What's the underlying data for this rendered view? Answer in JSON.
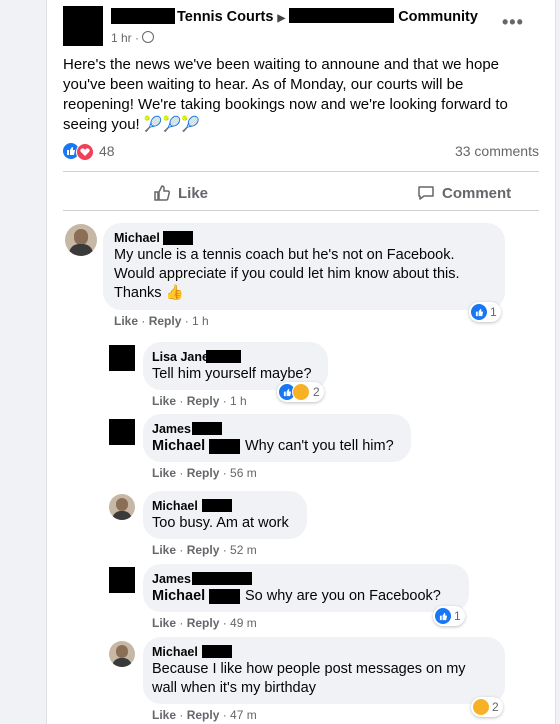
{
  "post": {
    "group_name": "Tennis Courts",
    "community_name": "Community",
    "time": "1 hr",
    "dot": "·",
    "body": "Here's the news we've been waiting to announe and that we hope you've been waiting to hear. As of Monday, our courts will be reopening! We're taking bookings now and we're looking forward to seeing you! 🎾🎾🎾",
    "reaction_count": "48",
    "comments_count": "33 comments",
    "like_label": "Like",
    "comment_label": "Comment"
  },
  "comments": [
    {
      "author": "Michael",
      "lines": [
        "My uncle is a tennis coach but he's not on Facebook.",
        "Would appreciate if you could let him know about this.",
        "Thanks 👍"
      ],
      "like": "Like",
      "reply": "Reply",
      "time": "1 h",
      "reactions": "1"
    },
    {
      "author": "Lisa Jane",
      "lines": [
        "Tell him yourself maybe?"
      ],
      "like": "Like",
      "reply": "Reply",
      "time": "1 h",
      "reactions": "2"
    },
    {
      "author": "James",
      "mention": "Michael",
      "lines": [
        "Why can't you tell him?"
      ],
      "like": "Like",
      "reply": "Reply",
      "time": "56 m"
    },
    {
      "author": "Michael",
      "lines": [
        "Too busy. Am at work"
      ],
      "like": "Like",
      "reply": "Reply",
      "time": "52 m"
    },
    {
      "author": "James",
      "mention": "Michael",
      "lines": [
        "So why are you on Facebook?"
      ],
      "like": "Like",
      "reply": "Reply",
      "time": "49 m",
      "reactions": "1"
    },
    {
      "author": "Michael",
      "lines": [
        "Because I like how people post messages on my",
        "wall when it's my birthday"
      ],
      "like": "Like",
      "reply": "Reply",
      "time": "47 m",
      "reactions": "2"
    }
  ],
  "icons": [
    "globe-icon",
    "more-options-icon",
    "like-reaction-icon",
    "love-reaction-icon",
    "like-outline-icon",
    "comment-icon",
    "haha-reaction-icon",
    "thumbs-up-emoji-icon"
  ],
  "colors": {
    "blue": "#1877f2",
    "text_secondary": "#65676b",
    "bubble": "#f0f2f5",
    "love": "#f33e58"
  }
}
